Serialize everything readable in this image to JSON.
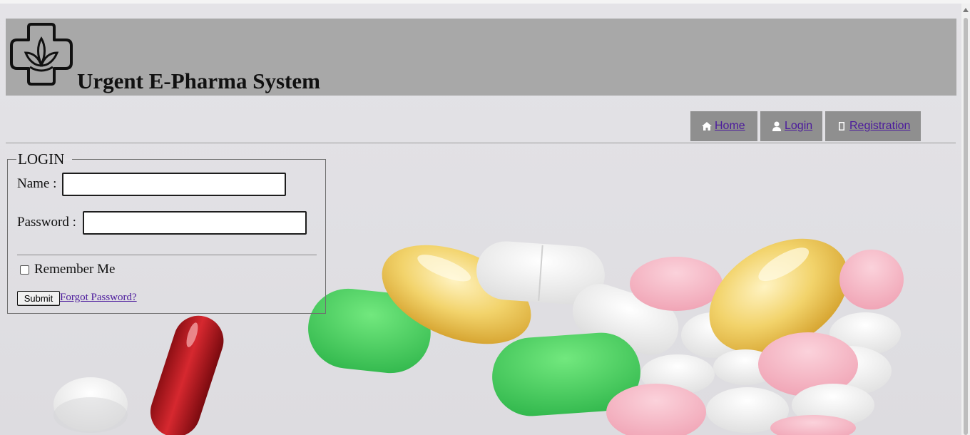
{
  "header": {
    "title": "Urgent E-Pharma System",
    "logo_icon": "pharmacy-cross-leaf-icon"
  },
  "nav": {
    "items": [
      {
        "label": " Home",
        "icon": "home-icon"
      },
      {
        "label": " Login",
        "icon": "user-icon"
      },
      {
        "label": " Registration",
        "icon": "missing-glyph-icon"
      }
    ]
  },
  "login": {
    "legend": "LOGIN",
    "name_label": "Name :",
    "name_value": "",
    "password_label": "Password :",
    "password_value": "",
    "remember_label": "Remember Me",
    "remember_checked": false,
    "submit_label": "Submit",
    "forgot_label": "Forgot Password?"
  },
  "colors": {
    "header_bg": "#a8a8a8",
    "nav_bg": "#8f8f8f",
    "link": "#4b1a9c",
    "page_bg": "#e6e5e9"
  }
}
